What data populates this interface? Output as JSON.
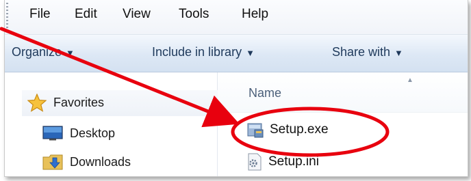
{
  "menu": {
    "file": "File",
    "edit": "Edit",
    "view": "View",
    "tools": "Tools",
    "help": "Help"
  },
  "toolbar": {
    "organize": "Organize",
    "include_in_library": "Include in library",
    "share_with": "Share with"
  },
  "nav": {
    "favorites": "Favorites",
    "desktop": "Desktop",
    "downloads": "Downloads"
  },
  "content": {
    "column_name": "Name",
    "files": [
      "Setup.exe",
      "Setup.ini"
    ]
  },
  "annotation": {
    "color": "#e8000e"
  },
  "icons": {
    "favorites": "star-icon",
    "desktop": "desktop-icon",
    "downloads": "downloads-folder-icon",
    "setup_exe": "installer-icon",
    "setup_ini": "settings-file-icon"
  }
}
